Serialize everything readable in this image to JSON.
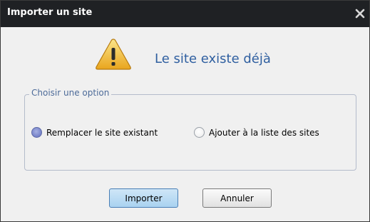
{
  "dialog": {
    "title": "Importer un site",
    "headline": "Le site existe déjà",
    "icons": {
      "close": "close-icon",
      "warning": "warning-icon"
    }
  },
  "options": {
    "legend": "Choisir une option",
    "replace": {
      "label": "Remplacer le site existant",
      "selected": true
    },
    "add": {
      "label": "Ajouter à la liste des sites",
      "selected": false
    }
  },
  "buttons": {
    "import": "Importer",
    "cancel": "Annuler"
  },
  "colors": {
    "titlebar_bg": "#1f2124",
    "headline": "#2f5fa0",
    "legend": "#4d6b99",
    "primary_button": "#a9d2f0"
  }
}
